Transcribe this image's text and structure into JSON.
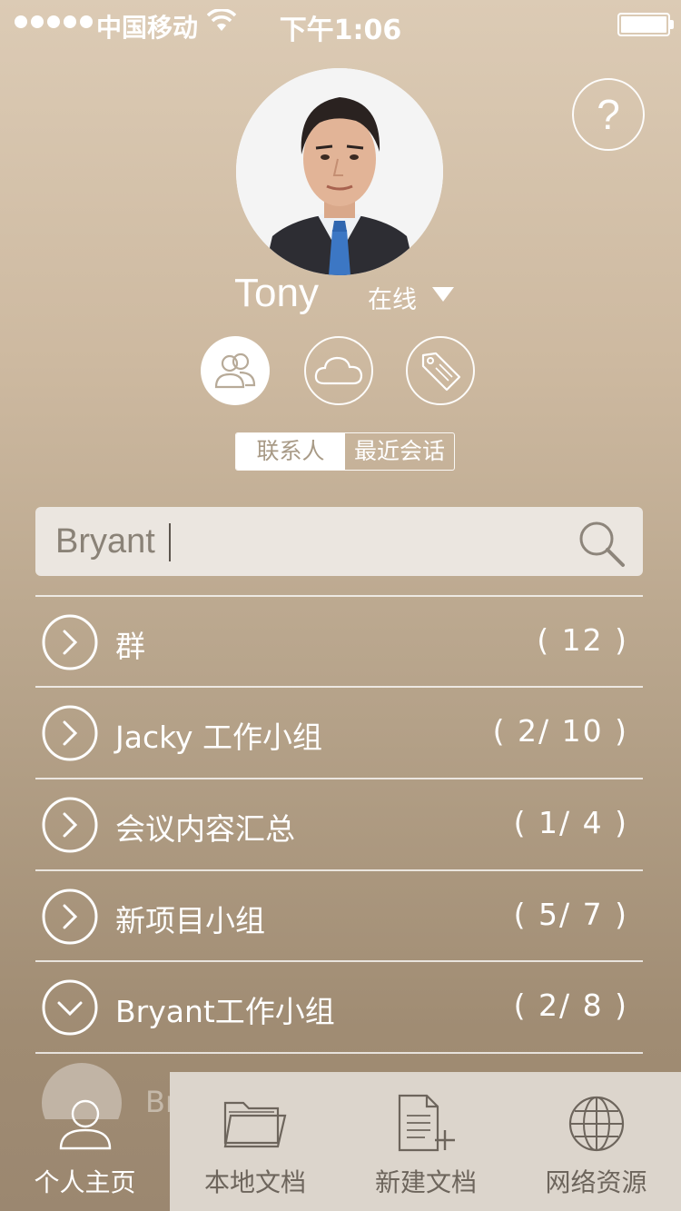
{
  "status_bar": {
    "carrier": "中国移动",
    "time": "下午1:06"
  },
  "profile": {
    "name": "Tony",
    "presence": "在线"
  },
  "help_label": "?",
  "segment": {
    "contacts": "联系人",
    "recent": "最近会话"
  },
  "search": {
    "value": "Bryant"
  },
  "groups": [
    {
      "label": "群",
      "count": "( 12 )",
      "expanded": false
    },
    {
      "label": "Jacky 工作小组",
      "count": "( 2/ 10 )",
      "expanded": false
    },
    {
      "label": "会议内容汇总",
      "count": "( 1/ 4 )",
      "expanded": false
    },
    {
      "label": "新项目小组",
      "count": "( 5/ 7 )",
      "expanded": false
    },
    {
      "label": "Bryant工作小组",
      "count": "( 2/ 8 )",
      "expanded": true
    }
  ],
  "preview_contact": {
    "name": "Bryant"
  },
  "tabs": [
    {
      "label": "个人主页",
      "icon": "person-icon",
      "active": true
    },
    {
      "label": "本地文档",
      "icon": "folder-icon",
      "active": false
    },
    {
      "label": "新建文档",
      "icon": "new-document-icon",
      "active": false
    },
    {
      "label": "网络资源",
      "icon": "globe-icon",
      "active": false
    }
  ]
}
